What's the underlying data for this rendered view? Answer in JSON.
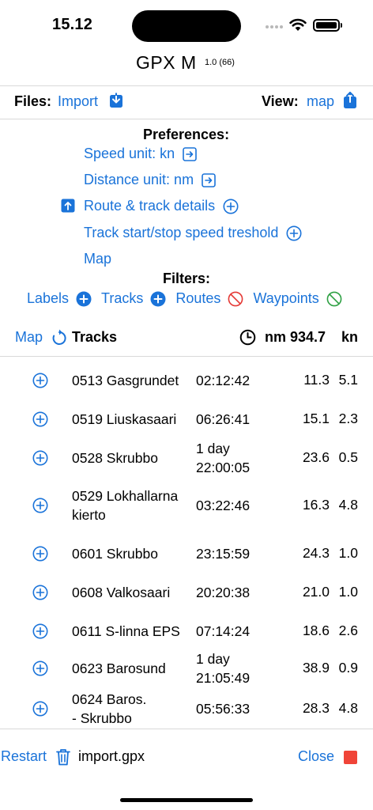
{
  "status_bar": {
    "time": "15.12"
  },
  "header": {
    "title": "GPX M",
    "version": "1.0 (66)"
  },
  "toolbar": {
    "files_label": "Files:",
    "import_label": "Import",
    "view_label": "View:",
    "view_value": "map"
  },
  "preferences": {
    "heading": "Preferences:",
    "speed_unit": "Speed unit: kn",
    "distance_unit": "Distance unit: nm",
    "route_track_details": "Route & track details",
    "track_speed_threshold": "Track start/stop speed treshold",
    "map": "Map"
  },
  "filters": {
    "heading": "Filters:",
    "labels": "Labels",
    "tracks": "Tracks",
    "routes": "Routes",
    "waypoints": "Waypoints"
  },
  "tracks_header": {
    "map_label": "Map",
    "tracks_label": "Tracks",
    "distance_total": "nm 934.7",
    "speed_unit": "kn"
  },
  "tracks": [
    {
      "name": "0513 Gasgrundet",
      "duration": "02:12:42",
      "distance": "11.3",
      "speed": "5.1"
    },
    {
      "name": "0519 Liuskasaari",
      "duration": "06:26:41",
      "distance": "15.1",
      "speed": "2.3"
    },
    {
      "name": "0528 Skrubbo",
      "duration_line1": "1 day",
      "duration_line2": "22:00:05",
      "distance": "23.6",
      "speed": "0.5"
    },
    {
      "name_line1": "0529 Lokhallarna",
      "name_line2": "kierto",
      "duration": "03:22:46",
      "distance": "16.3",
      "speed": "4.8"
    },
    {
      "name": "0601 Skrubbo",
      "duration": "23:15:59",
      "distance": "24.3",
      "speed": "1.0"
    },
    {
      "name": "0608 Valkosaari",
      "duration": "20:20:38",
      "distance": "21.0",
      "speed": "1.0"
    },
    {
      "name": "0611 S-linna EPS",
      "duration": "07:14:24",
      "distance": "18.6",
      "speed": "2.6"
    },
    {
      "name": "0623 Barosund",
      "duration_line1": "1 day",
      "duration_line2": "21:05:49",
      "distance": "38.9",
      "speed": "0.9"
    },
    {
      "name_line1": "0624 Baros.",
      "name_line2": "- Skrubbo",
      "duration": "05:56:33",
      "distance": "28.3",
      "speed": "4.8"
    }
  ],
  "footer": {
    "restart_label": "Restart",
    "file_name": "import.gpx",
    "close_label": "Close"
  },
  "colors": {
    "accent": "#1a73d9",
    "disabled_red": "#e53935",
    "enabled_green": "#2ea043",
    "stop_red": "#f04438"
  }
}
